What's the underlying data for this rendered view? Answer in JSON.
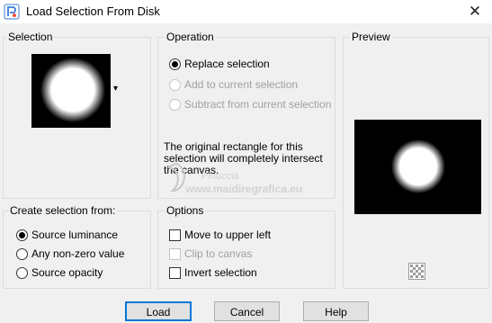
{
  "window": {
    "title": "Load Selection From Disk",
    "close_symbol": "✕"
  },
  "selection": {
    "group_label": "Selection",
    "dropdown_symbol": "▾"
  },
  "operation": {
    "group_label": "Operation",
    "options": [
      {
        "label": "Replace selection",
        "checked": true,
        "enabled": true
      },
      {
        "label": "Add to current selection",
        "checked": false,
        "enabled": false
      },
      {
        "label": "Subtract from current selection",
        "checked": false,
        "enabled": false
      }
    ],
    "info_text": "The original rectangle for this selection will completely intersect the canvas."
  },
  "preview": {
    "group_label": "Preview"
  },
  "create_from": {
    "group_label": "Create selection from:",
    "options": [
      {
        "label": "Source luminance",
        "checked": true
      },
      {
        "label": "Any non-zero value",
        "checked": false
      },
      {
        "label": "Source opacity",
        "checked": false
      }
    ]
  },
  "options": {
    "group_label": "Options",
    "items": [
      {
        "label": "Move to upper left",
        "checked": false,
        "enabled": true
      },
      {
        "label": "Clip to canvas",
        "checked": false,
        "enabled": false
      },
      {
        "label": "Invert selection",
        "checked": false,
        "enabled": true
      }
    ]
  },
  "buttons": {
    "load": "Load",
    "cancel": "Cancel",
    "help": "Help"
  },
  "watermark": {
    "name": "Pinuccia",
    "url": "www.maidiregrafica.eu"
  },
  "colors": {
    "accent": "#0078d7",
    "thumbnail_bg": "#000000",
    "selection_fill": "#ffffff"
  },
  "icons": {
    "app": "app-icon",
    "close": "close-icon",
    "dropdown": "chevron-down-icon",
    "preview_tool": "checkerboard-icon"
  }
}
